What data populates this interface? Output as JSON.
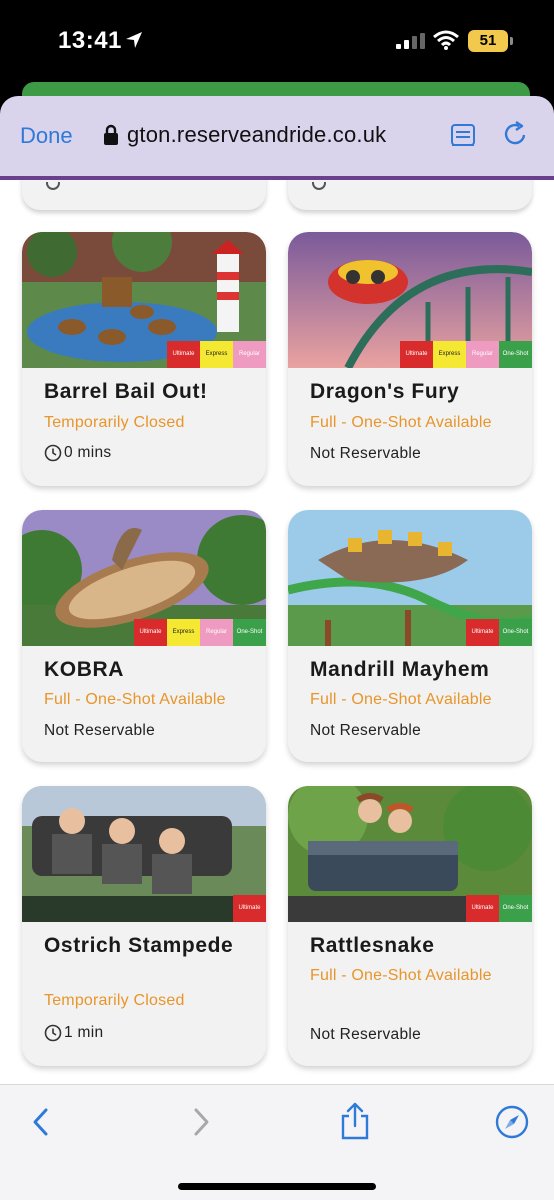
{
  "status_bar": {
    "time": "13:41",
    "battery": "51",
    "icons": [
      "location-arrow-icon",
      "signal-icon",
      "wifi-icon",
      "battery-icon"
    ]
  },
  "browser": {
    "done_label": "Done",
    "url": "gton.reserveandride.co.uk",
    "icons": [
      "lock-icon",
      "reader-icon",
      "reload-icon"
    ],
    "accent_color": "#2f7ad8"
  },
  "colors": {
    "status_orange": "#e8952a",
    "tag_ultimate": "#d92b2b",
    "tag_express": "#f5e832",
    "tag_regular": "#ef9ac0",
    "tag_oneshot": "#3aa04a"
  },
  "tag_labels": {
    "ultimate": "Ultimate",
    "express": "Express",
    "regular": "Regular",
    "oneshot": "One-Shot"
  },
  "rides": [
    {
      "name": "Barrel Bail Out!",
      "status": "Temporarily Closed",
      "wait": "0 mins",
      "tags": [
        "Ultimate",
        "Express",
        "Regular"
      ]
    },
    {
      "name": "Dragon's Fury",
      "status": "Full - One-Shot Available",
      "wait": "Not Reservable",
      "tags": [
        "Ultimate",
        "Express",
        "Regular",
        "One-Shot"
      ]
    },
    {
      "name": "KOBRA",
      "status": "Full - One-Shot Available",
      "wait": "Not Reservable",
      "tags": [
        "Ultimate",
        "Express",
        "Regular",
        "One-Shot"
      ]
    },
    {
      "name": "Mandrill Mayhem",
      "status": "Full - One-Shot Available",
      "wait": "Not Reservable",
      "tags": [
        "Ultimate",
        "One-Shot"
      ]
    },
    {
      "name": "Ostrich Stampede",
      "status": "Temporarily Closed",
      "wait": "1 min",
      "tags": [
        "Ultimate"
      ]
    },
    {
      "name": "Rattlesnake",
      "status": "Full - One-Shot Available",
      "wait": "Not Reservable",
      "tags": [
        "Ultimate",
        "One-Shot"
      ]
    }
  ],
  "toolbar": {
    "icons": [
      "back-icon",
      "forward-icon",
      "share-icon",
      "compass-icon"
    ]
  }
}
